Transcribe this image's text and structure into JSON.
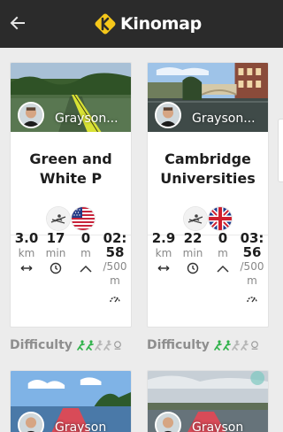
{
  "app": {
    "brand_name": "Kinomap",
    "back_icon": "arrow-left-icon",
    "brand_color": "#f5c71a",
    "bar_color": "#2b2b2b"
  },
  "videos": [
    {
      "author": "Grayson...",
      "title": "Green and White P",
      "country_flag": "us-flag-icon",
      "sport_icon": "rowing-icon",
      "stats": {
        "distance": {
          "value": "3.0",
          "unit": "km"
        },
        "duration": {
          "value": "17",
          "unit": "min"
        },
        "elevation": {
          "value": "0",
          "unit": "m"
        },
        "pace": {
          "value": "02:58",
          "unit": "/500m"
        }
      }
    },
    {
      "author": "Grayson...",
      "title": "Cambridge Universities",
      "country_flag": "uk-flag-icon",
      "sport_icon": "rowing-icon",
      "stats": {
        "distance": {
          "value": "2.9",
          "unit": "km"
        },
        "duration": {
          "value": "22",
          "unit": "min"
        },
        "elevation": {
          "value": "0",
          "unit": "m"
        },
        "pace": {
          "value": "03:56",
          "unit": "/500m"
        }
      }
    },
    {
      "author": "Grayson",
      "title": ""
    },
    {
      "author": "Grayson",
      "title": ""
    }
  ],
  "difficulty": {
    "label": "Difficulty",
    "items": [
      {
        "filled": 2,
        "total": 5
      },
      {
        "filled": 2,
        "total": 5
      }
    ],
    "filled_color": "#2fb24a",
    "empty_color": "#b5b5b5"
  }
}
